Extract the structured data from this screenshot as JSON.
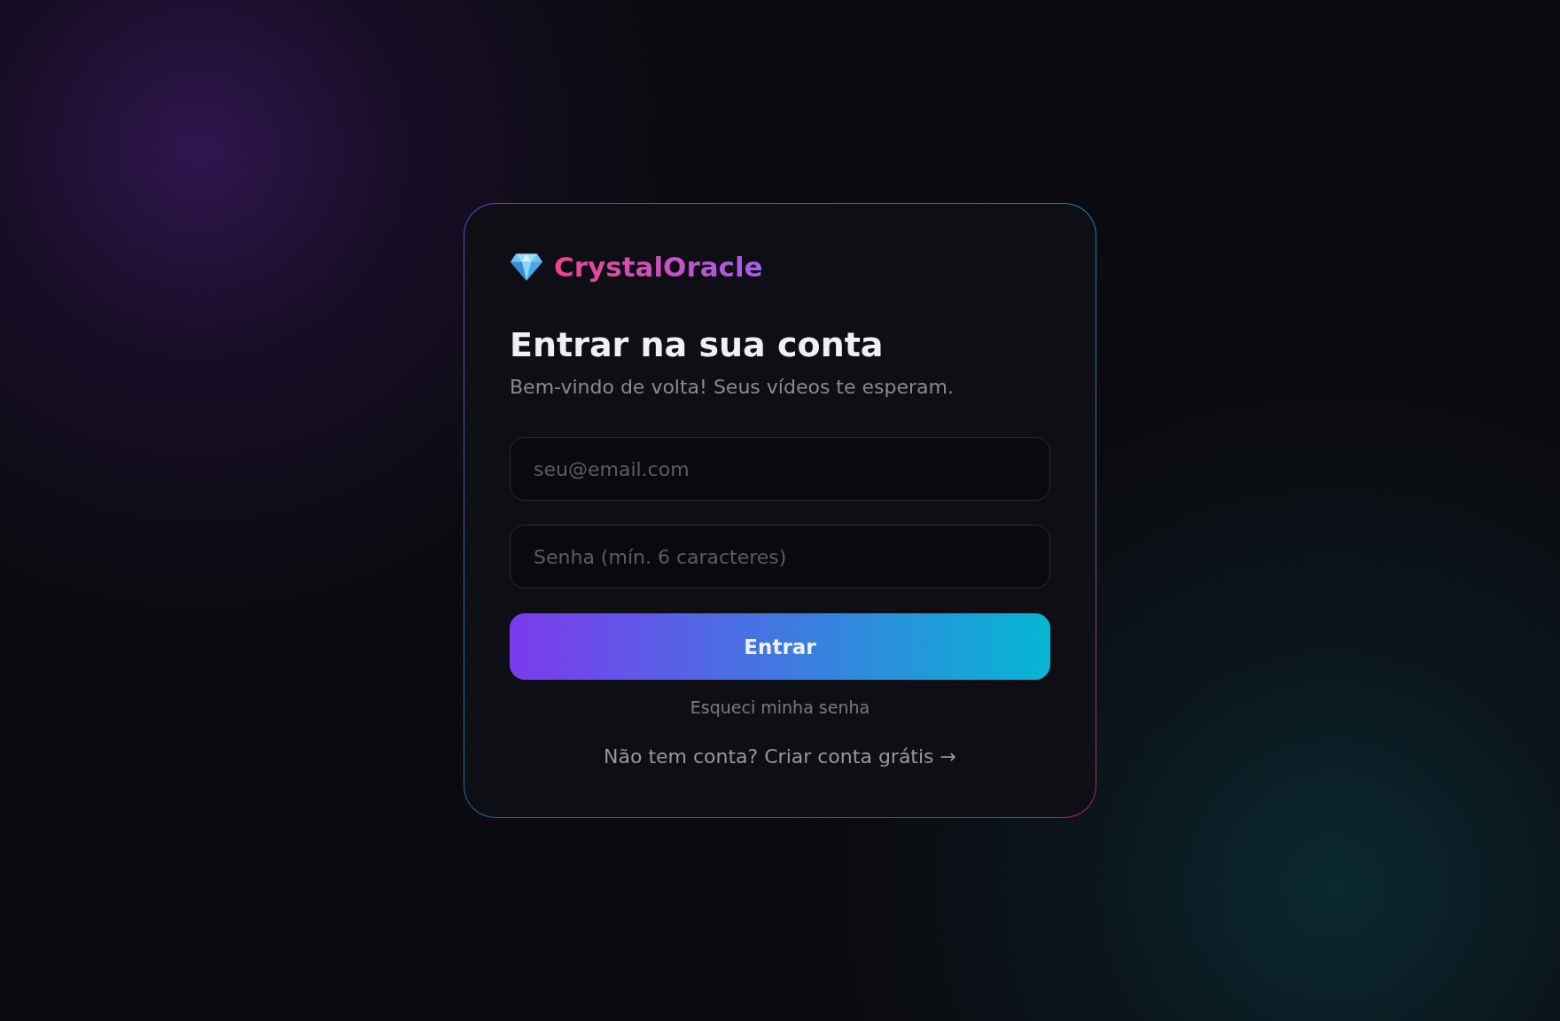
{
  "brand": {
    "name": "CrystalOracle"
  },
  "heading": "Entrar na sua conta",
  "subtitle": "Bem-vindo de volta! Seus vídeos te esperam.",
  "fields": [
    {
      "placeholder": "seu@email.com"
    },
    {
      "placeholder": "Senha (mín. 6 caracteres)"
    }
  ],
  "submit_button": "Entrar",
  "forgot_link": "Esqueci minha senha",
  "signup_link": "Não tem conta? Criar conta grátis →"
}
